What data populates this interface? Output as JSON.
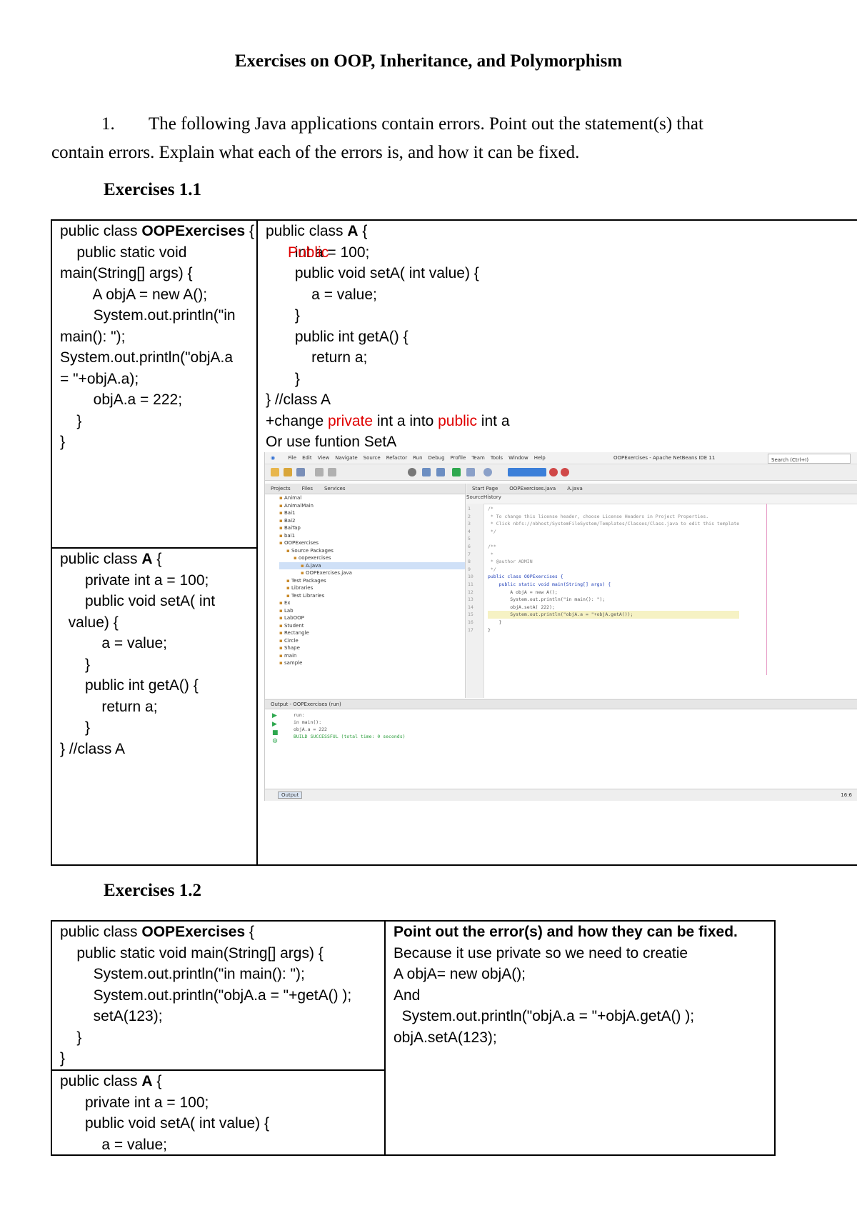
{
  "title": "Exercises on OOP, Inheritance, and Polymorphism",
  "question": {
    "number": "1.",
    "text_line1": "The following Java applications contain errors. Point out the statement(s) that",
    "text_line2": "contain errors. Explain what each of the errors is, and how it can be fixed."
  },
  "ex11": {
    "heading": "Exercises 1.1",
    "left_top_code": [
      "public class OOPExercises {",
      "    public static void",
      "main(String[] args) {",
      "        A objA = new A();",
      "        System.out.println(\"in",
      "main(): \");",
      "",
      "System.out.println(\"objA.a",
      "= \"+objA.a);",
      "        objA.a = 222;",
      "    }",
      "}"
    ],
    "left_bottom_code": [
      "public class A {",
      "      private int a = 100;",
      "      public void setA( int",
      "  value) {",
      "          a = value;",
      "      }",
      "      public int getA() {",
      "          return a;",
      "      }",
      "} //class A"
    ],
    "right_code": [
      "public class A {",
      "       int a = 100;",
      "       public void setA( int value) {",
      "           a = value;",
      "       }",
      "       public int getA() {",
      "           return a;",
      "       }",
      "} //class A"
    ],
    "right_public_word": "Public",
    "note_prefix": "+change ",
    "note_private": "private",
    "note_middle": " int a into ",
    "note_public": "public",
    "note_suffix": " int a",
    "note_line2": "Or use funtion SetA",
    "ide": {
      "window_title": "OOPExercises - Apache NetBeans IDE 11",
      "search_placeholder": "Search (Ctrl+I)",
      "menu": [
        "File",
        "Edit",
        "View",
        "Navigate",
        "Source",
        "Refactor",
        "Run",
        "Debug",
        "Profile",
        "Team",
        "Tools",
        "Window",
        "Help"
      ],
      "proj_tabs": [
        "Projects",
        "Files",
        "Services"
      ],
      "editor_tabs": [
        "Start Page",
        "OOPExercises.java",
        "A.java"
      ],
      "editor_toolbar": [
        "Source",
        "History"
      ],
      "tree": [
        "Animal",
        "AnimalMain",
        "Bai1",
        "Bai2",
        "BaiTap",
        "bai1",
        "OOPExercises",
        "Source Packages",
        "oopexercises",
        "A.java",
        "OOPExercises.java",
        "Test Packages",
        "Libraries",
        "Test Libraries",
        "Ex",
        "Lab",
        "LabOOP",
        "Student",
        "Rectangle",
        "Circle",
        "Shape",
        "main",
        "sample"
      ],
      "code_lines": [
        "/*",
        " * To change this license header, choose License Headers in Project Properties.",
        " * Click nbfs://nbhost/SystemFileSystem/Templates/Classes/Class.java to edit this template",
        " */",
        "",
        "/**",
        " *",
        " * @author ADMIN",
        " */",
        "public class OOPExercises {",
        "    public static void main(String[] args) {",
        "        A objA = new A();",
        "        System.out.println(\"in main(): \");",
        "        objA.setA( 222);",
        "        System.out.println(\"objA.a = \"+objA.getA());",
        "    }",
        "}"
      ],
      "gutter_nums": [
        "1",
        "2",
        "3",
        "4",
        "5",
        "6",
        "7",
        "8",
        "9",
        "10",
        "11",
        "12",
        "13",
        "14",
        "15",
        "16",
        "17"
      ],
      "output_title": "Output - OOPExercises (run)",
      "output_lines": [
        "run:",
        "in main():",
        "objA.a = 222",
        "BUILD SUCCESSFUL (total time: 0 seconds)"
      ],
      "status_tab": "Output",
      "status_pos": "16:6"
    }
  },
  "ex12": {
    "heading": "Exercises 1.2",
    "left_top_code": [
      "public class OOPExercises {",
      "    public static void main(String[] args) {",
      "        System.out.println(\"in main(): \");",
      "        System.out.println(\"objA.a = \"+getA() );",
      "        setA(123);",
      "    }",
      "}"
    ],
    "left_bottom_code": [
      "public class A {",
      "      private int a = 100;",
      "      public void setA( int value) {",
      "          a = value;"
    ],
    "right_code": [
      "Point out the error(s) and how they can be fixed.",
      "",
      "Because it use private so we need to creatie",
      "A objA= new objA();",
      "And",
      "  System.out.println(\"objA.a = \"+objA.getA() );",
      "objA.setA(123);"
    ]
  }
}
